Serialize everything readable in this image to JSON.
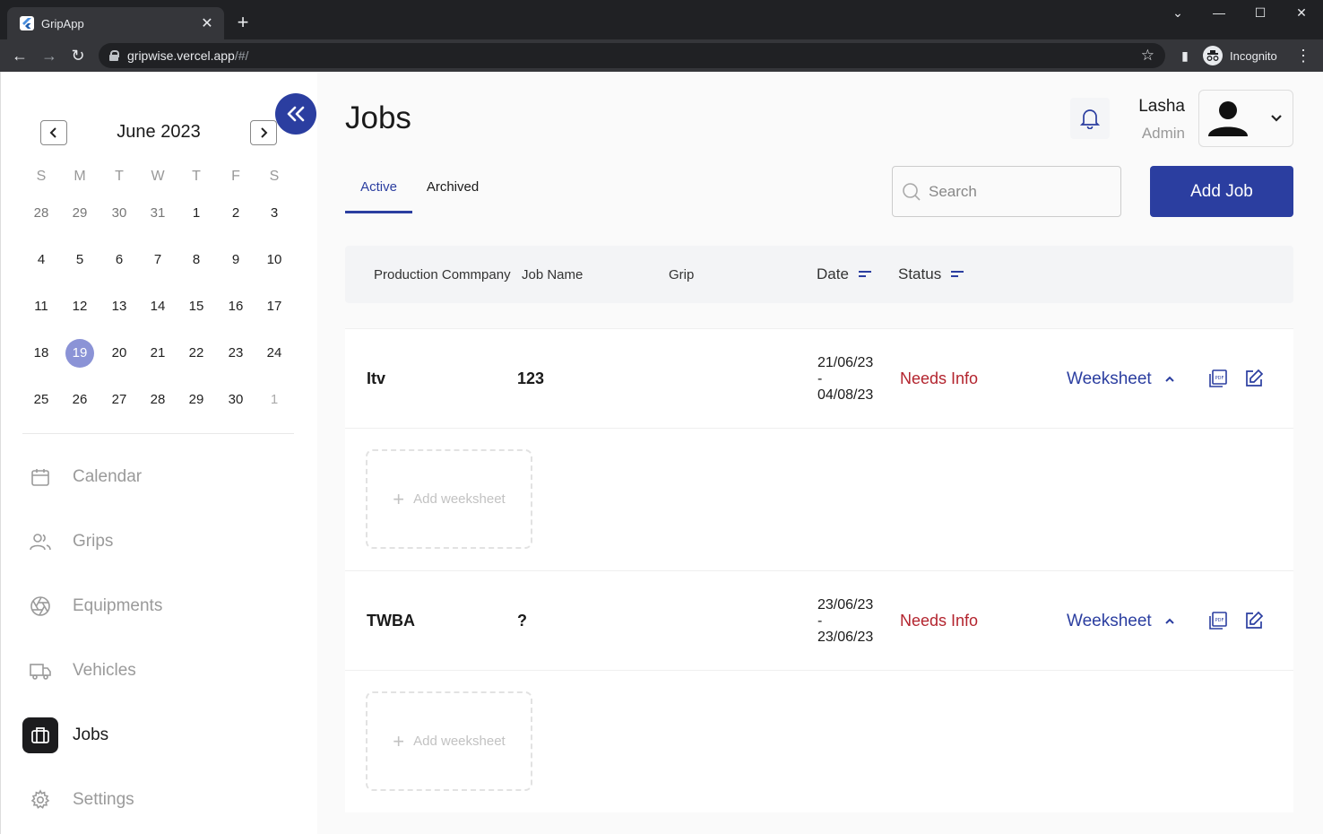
{
  "browser": {
    "tab_title": "GripApp",
    "url_host": "gripwise.vercel.app",
    "url_path": "/#/",
    "profile_label": "Incognito"
  },
  "calendar": {
    "title": "June 2023",
    "weekdays": [
      "S",
      "M",
      "T",
      "W",
      "T",
      "F",
      "S"
    ],
    "weeks": [
      [
        "28",
        "29",
        "30",
        "31",
        "1",
        "2",
        "3"
      ],
      [
        "4",
        "5",
        "6",
        "7",
        "8",
        "9",
        "10"
      ],
      [
        "11",
        "12",
        "13",
        "14",
        "15",
        "16",
        "17"
      ],
      [
        "18",
        "19",
        "20",
        "21",
        "22",
        "23",
        "24"
      ],
      [
        "25",
        "26",
        "27",
        "28",
        "29",
        "30",
        "1"
      ]
    ],
    "selected_day": "19"
  },
  "sidebar": {
    "items": [
      {
        "label": "Calendar",
        "icon": "calendar-icon"
      },
      {
        "label": "Grips",
        "icon": "users-icon"
      },
      {
        "label": "Equipments",
        "icon": "aperture-icon"
      },
      {
        "label": "Vehicles",
        "icon": "truck-icon"
      },
      {
        "label": "Jobs",
        "icon": "briefcase-icon",
        "active": true
      },
      {
        "label": "Settings",
        "icon": "gear-icon"
      }
    ]
  },
  "header": {
    "title": "Jobs",
    "user_name": "Lasha",
    "user_role": "Admin"
  },
  "tabs": {
    "active": "Active",
    "archived": "Archived"
  },
  "search": {
    "placeholder": "Search"
  },
  "add_job_label": "Add Job",
  "table": {
    "columns": [
      "Production Commpany",
      "Job Name",
      "Grip",
      "Date",
      "Status"
    ],
    "rows": [
      {
        "company": "Itv",
        "job_name": "123",
        "grip": "",
        "date_start": "21/06/23",
        "date_sep": "-",
        "date_end": "04/08/23",
        "status": "Needs Info",
        "weeksheet": "Weeksheet"
      },
      {
        "company": "TWBA",
        "job_name": "?",
        "grip": "",
        "date_start": "23/06/23",
        "date_sep": "-",
        "date_end": "23/06/23",
        "status": "Needs Info",
        "weeksheet": "Weeksheet"
      }
    ],
    "add_weeksheet_label": "Add weeksheet"
  },
  "colors": {
    "accent": "#2b3ea0",
    "status_needs_info": "#b3242e",
    "selected_day": "#8b93d6"
  }
}
